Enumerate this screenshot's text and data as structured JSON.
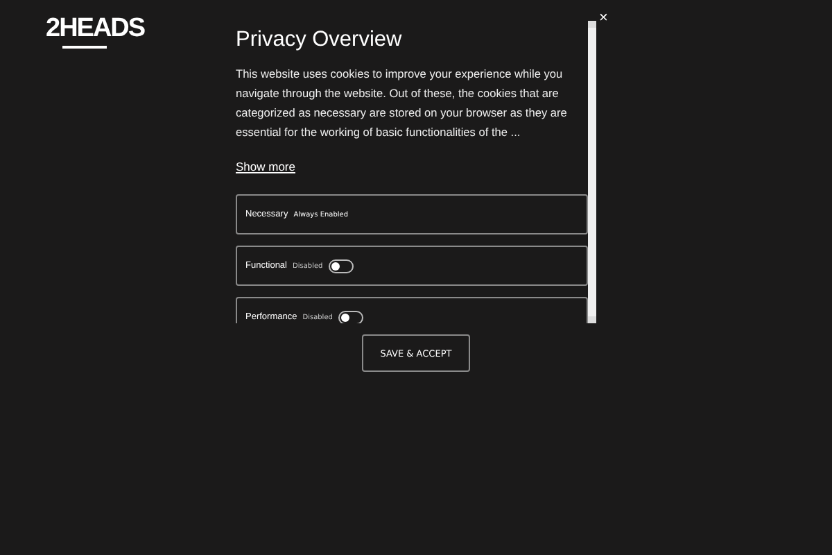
{
  "logo": {
    "text": "2HEADS"
  },
  "modal": {
    "close": "×",
    "title": "Privacy Overview",
    "body": "This website uses cookies to improve your experience while you navigate through the website. Out of these, the cookies that are categorized as necessary are stored on your browser as they are essential for the working of basic functionalities of the ...",
    "show_more": "Show more",
    "categories": [
      {
        "kind": "always",
        "name": "Necessary",
        "status": "Always Enabled"
      },
      {
        "kind": "toggle",
        "name": "Functional",
        "status": "Disabled",
        "on": false
      },
      {
        "kind": "toggle",
        "name": "Performance",
        "status": "Disabled",
        "on": false
      }
    ],
    "button": "SAVE & ACCEPT"
  }
}
